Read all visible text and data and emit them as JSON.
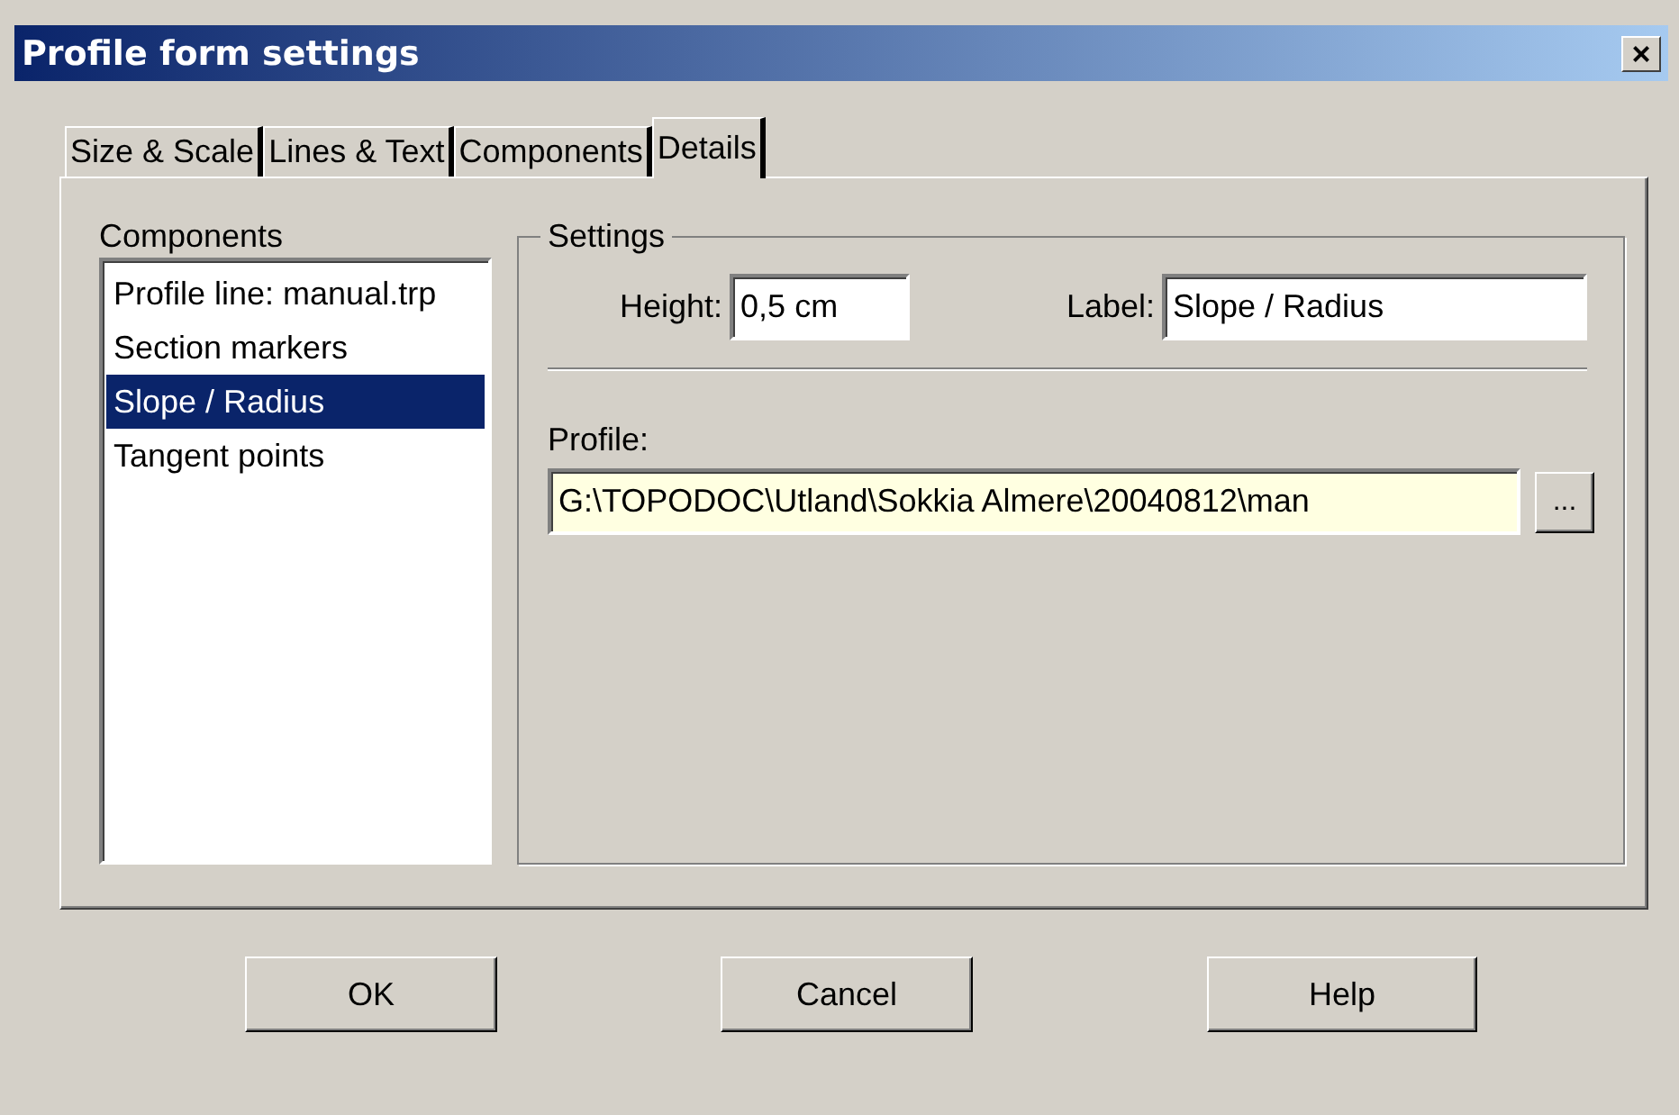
{
  "window": {
    "title": "Profile form settings",
    "close": "×"
  },
  "tabs": [
    {
      "label": "Size & Scale",
      "selected": false
    },
    {
      "label": "Lines & Text",
      "selected": false
    },
    {
      "label": "Components",
      "selected": false
    },
    {
      "label": "Details",
      "selected": true
    }
  ],
  "components": {
    "label": "Components",
    "items": [
      {
        "label": "Profile line: manual.trp",
        "selected": false
      },
      {
        "label": "Section markers",
        "selected": false
      },
      {
        "label": "Slope / Radius",
        "selected": true
      },
      {
        "label": "Tangent points",
        "selected": false
      }
    ]
  },
  "settings": {
    "title": "Settings",
    "height": {
      "label": "Height:",
      "value": "0,5 cm"
    },
    "label_field": {
      "label": "Label:",
      "value": "Slope / Radius"
    },
    "profile": {
      "label": "Profile:",
      "value": "G:\\TOPODOC\\Utland\\Sokkia Almere\\20040812\\man",
      "browse": "..."
    }
  },
  "buttons": [
    "OK",
    "Cancel",
    "Help"
  ]
}
